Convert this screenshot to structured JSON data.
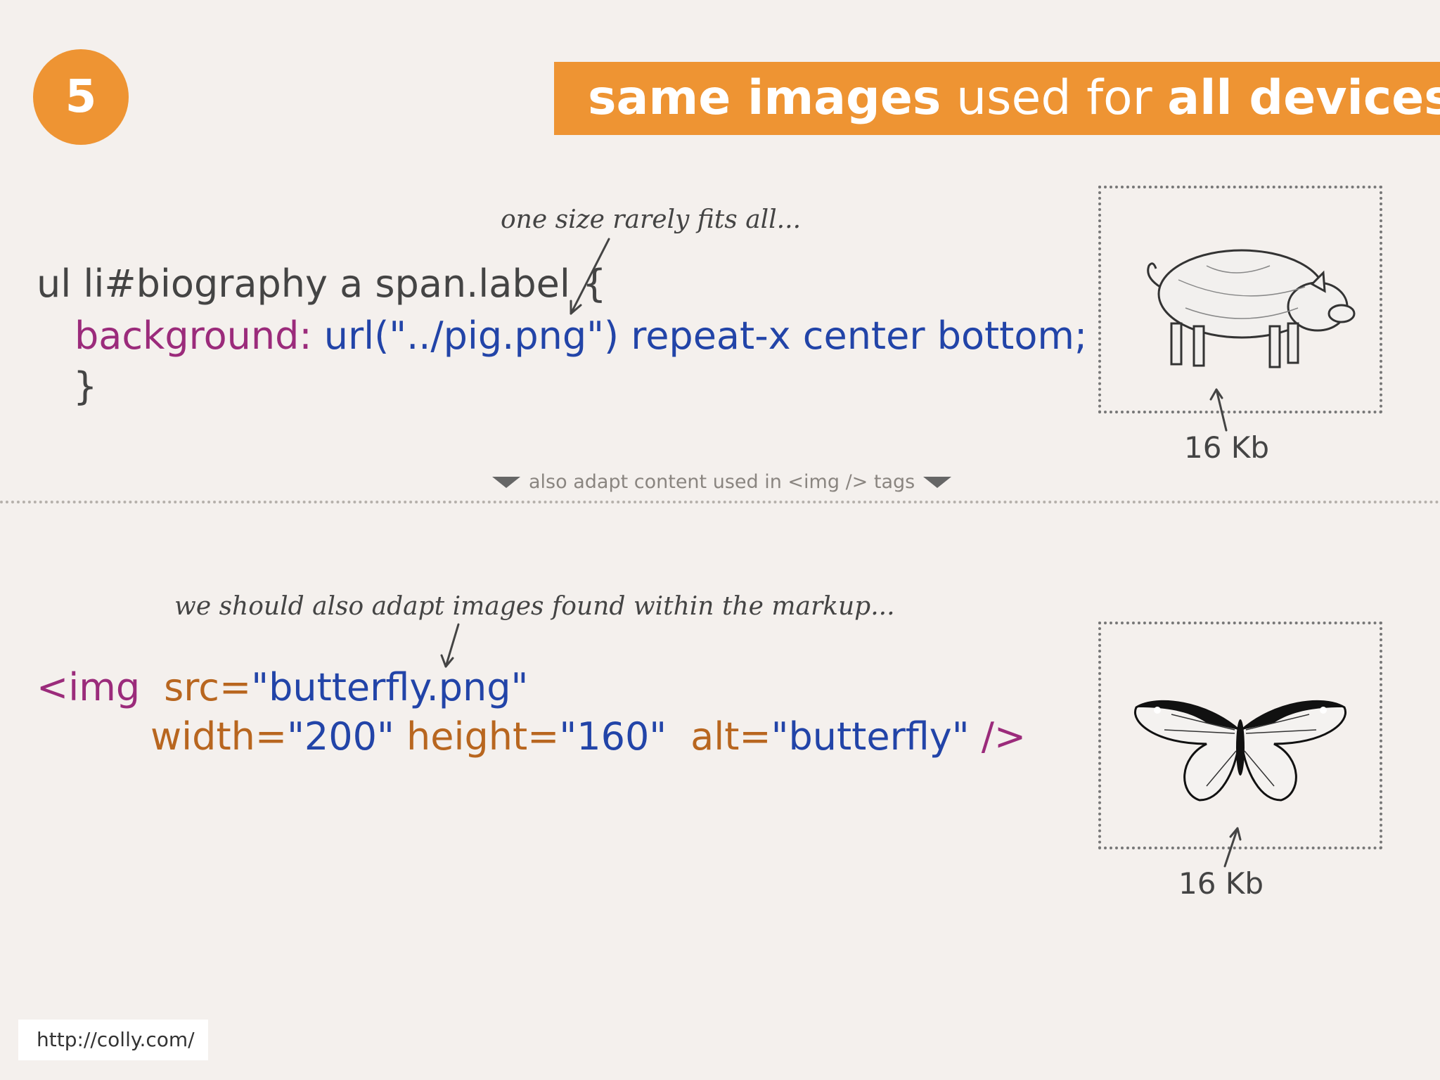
{
  "slide": {
    "number": "5",
    "title_bold_1": "same images",
    "title_regular": " used for ",
    "title_bold_2": "all devices..."
  },
  "top_section": {
    "annotation": "one size rarely fits all...",
    "code_line1": "ul li#biography a span.label {",
    "code_prop": "background:",
    "code_value": " url(\"../pig.png\") repeat-x center bottom;",
    "code_close": "}",
    "image_icon": "pig-image",
    "size_label": "16 Kb"
  },
  "divider_caption": "also adapt content used in <img /> tags",
  "bottom_section": {
    "annotation": "we should also adapt images found within the markup...",
    "tag_open": "<img",
    "src_attr": "src=",
    "src_value": "\"butterfly.png\"",
    "width_attr": "width=",
    "width_value": "\"200\"",
    "height_attr": " height=",
    "height_value": "\"160\"",
    "alt_attr": "alt=",
    "alt_value": "\"butterfly\"",
    "tag_close": " />",
    "image_icon": "butterfly-image",
    "size_label": "16 Kb"
  },
  "footer": {
    "url": "http://colly.com/"
  },
  "colors": {
    "accent": "#ee9433",
    "purple": "#9b2b7b",
    "blue": "#2244a8",
    "brown": "#b8661f"
  }
}
